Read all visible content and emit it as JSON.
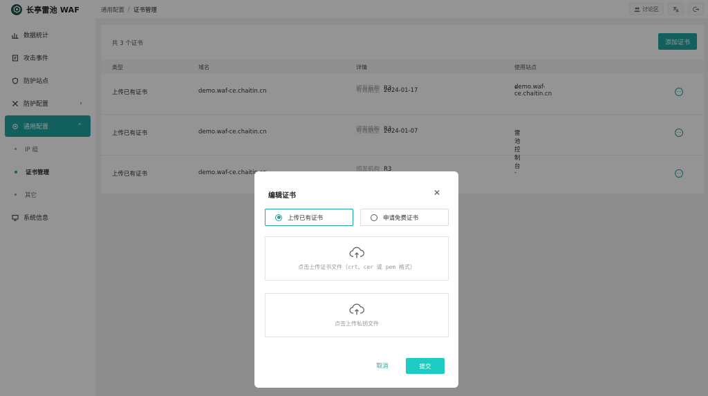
{
  "app": {
    "title": "长亭雷池 WAF"
  },
  "sidebar": {
    "items": [
      {
        "label": "数据统计"
      },
      {
        "label": "攻击事件"
      },
      {
        "label": "防护站点"
      },
      {
        "label": "防护配置"
      },
      {
        "label": "通用配置"
      },
      {
        "label": "系统信息"
      }
    ],
    "subitems": [
      {
        "label": "IP 组"
      },
      {
        "label": "证书管理"
      },
      {
        "label": "其它"
      }
    ]
  },
  "header": {
    "breadcrumb_parent": "通用配置",
    "breadcrumb_sep": "/",
    "breadcrumb_current": "证书管理",
    "discuss_label": "讨论区"
  },
  "main": {
    "count_text": "共 3 个证书",
    "add_button": "添加证书",
    "columns": [
      "类型",
      "域名",
      "详情",
      "使用站点"
    ],
    "rows": [
      {
        "type": "上传已有证书",
        "domain": "demo.waf-ce.chaitin.cn",
        "issuer_key": "颁发机构",
        "issuer": "R3",
        "expiry_key": "有效期至",
        "expiry": "2024-01-17",
        "site_line1": "demo.waf-ce.chaitin.cn",
        "site_line2": "*"
      },
      {
        "type": "上传已有证书",
        "domain": "demo.waf-ce.chaitin.cn",
        "issuer_key": "颁发机构",
        "issuer": "R3",
        "expiry_key": "有效期至",
        "expiry": "2024-01-07",
        "site_line1": "雷池控制台",
        "site_line2": ""
      },
      {
        "type": "上传已有证书",
        "domain": "demo.waf-ce.chaitin.cn",
        "issuer_key": "颁发机构",
        "issuer": "R3",
        "expiry_key": "",
        "expiry": "",
        "site_line1": "-",
        "site_line2": ""
      }
    ]
  },
  "modal": {
    "title": "编辑证书",
    "option_upload": "上传已有证书",
    "option_free": "申请免费证书",
    "upload_cert_text": "点击上传证书文件（crt、cer 或 pem 格式）",
    "upload_key_text": "点击上传私钥文件",
    "cancel": "取消",
    "submit": "提交"
  },
  "colors": {
    "accent": "#1ea6a0",
    "submit": "#1ecbc2",
    "logo": "#1b5a4e"
  }
}
